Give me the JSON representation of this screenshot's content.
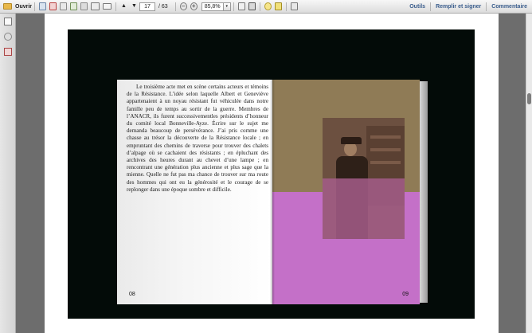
{
  "toolbar": {
    "open_label": "Ouvrir",
    "page_current": "17",
    "page_total": "/ 63",
    "zoom": "85,8%",
    "zoom_dropdown_glyph": "▾",
    "links": {
      "tools": "Outils",
      "fill_sign": "Remplir et signer",
      "comment": "Commentaire"
    }
  },
  "icons": {
    "folder": "folder-icon",
    "create_pdf": "create-pdf-icon",
    "edit": "edit-icon",
    "upload": "upload-icon",
    "save": "save-icon",
    "print": "print-icon",
    "email": "email-icon",
    "prev_page": "arrow-up-icon",
    "next_page": "arrow-down-icon",
    "zoom_out": "minus-icon",
    "zoom_in": "plus-icon",
    "fit_page": "fit-page-icon",
    "fit_width": "fit-width-icon",
    "comment": "comment-icon",
    "highlight": "highlight-icon",
    "expand": "expand-icon",
    "nav_pages": "pages-icon",
    "nav_attach": "attachment-icon",
    "nav_sign": "signature-icon"
  },
  "colors": {
    "link_blue": "#3a5d8c",
    "page_pink": "#c470c8",
    "page_brown": "#8f7b56",
    "backdrop": "#030b08"
  },
  "book": {
    "left_page_text": "Le troisième acte met en scène certains acteurs et témoins de la Résistance. L’idée selon laquelle Albert et Geneviève appartenaient à un noyau résistant fut véhiculée dans notre famille peu de temps au sortir de la guerre. Membres de l’ANACR, ils furent successivementles présidents d’honneur du comité local Bonneville-Ayze. Écrire sur le sujet me demanda beaucoup de persévérance. J’ai pris comme une chasse au trésor la découverte de la Résistance locale ; en empruntant des chemins de traverse pour trouver des chalets d’alpage où se cachaient des résistants ; en épluchant des archives des heures durant au chevet d’une lampe ; en rencontrant une génération plus ancienne et plus sage que la mienne. Quelle ne fut pas ma chance de trouver sur ma route des hommes qui ont eu la générosité et le courage de se replonger dans une époque sombre et difficile.",
    "left_page_number": "08",
    "right_page_number": "09"
  }
}
